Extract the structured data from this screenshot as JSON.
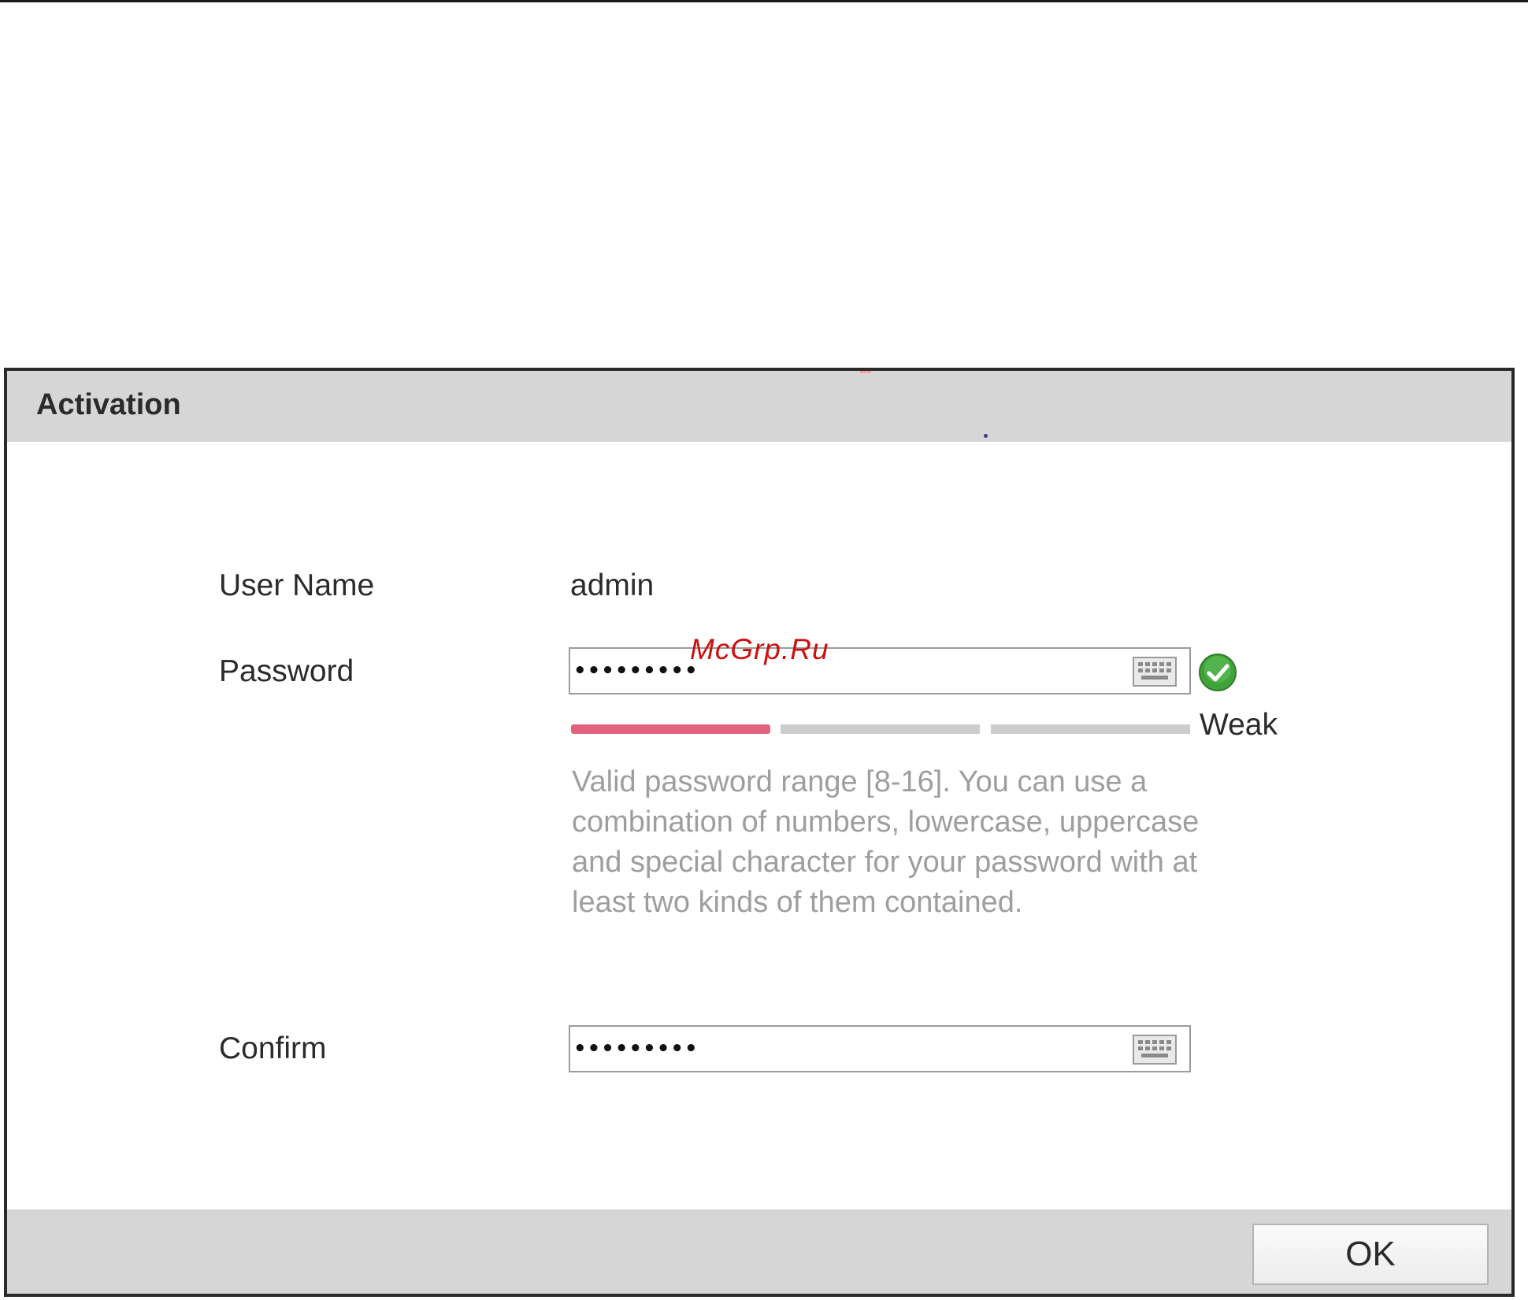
{
  "dialog": {
    "title": "Activation",
    "user_name_label": "User Name",
    "user_name_value": "admin",
    "password_label": "Password",
    "password_value": "•••••••••",
    "confirm_label": "Confirm",
    "confirm_value": "•••••••••",
    "strength": {
      "label": "Weak",
      "level": "1 of 3",
      "active_color": "#e2617c",
      "inactive_color": "#cdcdcd"
    },
    "hint": "Valid password range [8-16]. You can use a combination of numbers, lowercase, uppercase and special character for your password with at least two kinds of them contained.",
    "ok_label": "OK"
  },
  "watermark": "McGrp.Ru",
  "icons": {
    "keyboard": "keyboard-icon",
    "valid": "check-circle-icon"
  },
  "colors": {
    "header_bg": "#d6d6d6",
    "valid_green": "#3fa33a"
  }
}
